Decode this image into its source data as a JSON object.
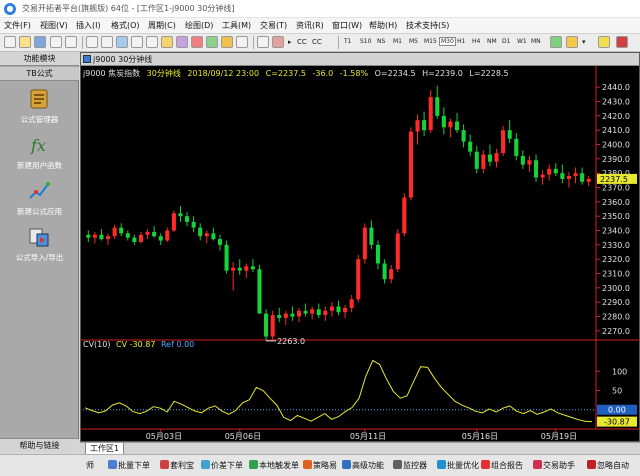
{
  "window": {
    "title": "交易开拓者平台(旗舰版) 64位 - [工作区1-j9000 30分钟线]"
  },
  "menu": [
    "文件(F)",
    "视图(V)",
    "插入(I)",
    "格式(O)",
    "周期(C)",
    "绘图(D)",
    "工具(M)",
    "交易(T)",
    "资讯(R)",
    "窗口(W)",
    "帮助(H)",
    "技术支持(S)"
  ],
  "toolbar": {
    "cc_label": "CC",
    "periods": [
      "T1",
      "S10",
      "NS",
      "M1",
      "M5",
      "M15",
      "M30",
      "H1",
      "H4",
      "NM",
      "D1",
      "W1",
      "MN",
      "MN"
    ],
    "active_period": "M30"
  },
  "left_panel": {
    "header": "功能模块",
    "tab": "TB公式",
    "tools": [
      "公式管理器",
      "新建用户函数",
      "新建公式应用",
      "公式导入/导出"
    ],
    "footer": "帮助与链接"
  },
  "chart": {
    "window_title": "j9000 30分钟线",
    "info": {
      "symbol": "j9000 焦炭指数",
      "period": "30分钟线",
      "datetime": "2018/09/12 23:00",
      "close": "C=2237.5",
      "change": "-36.0",
      "change_pct": "-1.58%",
      "open": "O=2234.5",
      "high": "H=2239.0",
      "low": "L=2228.5"
    },
    "cv_info": {
      "name": "CV(10)",
      "value": "CV -30.87",
      "ref": "Ref 0.00"
    },
    "low_label": "2263.0",
    "price_marker": "2237.5",
    "cv_marker_zero": "0.00",
    "cv_marker_value": "-30.87",
    "colors": {
      "up": "#ff2a2a",
      "down": "#18d23c",
      "cv_line": "#e8e830",
      "axis": "#d42020",
      "ref_line": "#4ea8ff",
      "axis_text": "#e0e0e0"
    }
  },
  "chart_data": {
    "type": "candlestick",
    "price_axis": {
      "ticks": [
        2270.0,
        2280.0,
        2290.0,
        2300.0,
        2310.0,
        2320.0,
        2330.0,
        2340.0,
        2350.0,
        2360.0,
        2370.0,
        2380.0,
        2390.0,
        2400.0,
        2410.0,
        2420.0,
        2430.0,
        2440.0
      ],
      "range": [
        2265,
        2445
      ]
    },
    "cv_axis": {
      "ticks": [
        100,
        50
      ],
      "range": [
        -45,
        145
      ]
    },
    "x_labels": [
      "05月03日",
      "05月06日",
      "05月11日",
      "05月16日",
      "05月19日"
    ],
    "bars": [
      {
        "o": 2337,
        "h": 2340,
        "l": 2332,
        "c": 2335
      },
      {
        "o": 2335,
        "h": 2339,
        "l": 2331,
        "c": 2337
      },
      {
        "o": 2337,
        "h": 2341,
        "l": 2333,
        "c": 2334
      },
      {
        "o": 2334,
        "h": 2338,
        "l": 2330,
        "c": 2336
      },
      {
        "o": 2336,
        "h": 2344,
        "l": 2334,
        "c": 2342
      },
      {
        "o": 2342,
        "h": 2345,
        "l": 2336,
        "c": 2338
      },
      {
        "o": 2338,
        "h": 2340,
        "l": 2333,
        "c": 2335
      },
      {
        "o": 2335,
        "h": 2337,
        "l": 2330,
        "c": 2332
      },
      {
        "o": 2332,
        "h": 2339,
        "l": 2331,
        "c": 2337
      },
      {
        "o": 2337,
        "h": 2341,
        "l": 2334,
        "c": 2339
      },
      {
        "o": 2339,
        "h": 2343,
        "l": 2335,
        "c": 2336
      },
      {
        "o": 2336,
        "h": 2338,
        "l": 2330,
        "c": 2333
      },
      {
        "o": 2333,
        "h": 2342,
        "l": 2332,
        "c": 2340
      },
      {
        "o": 2340,
        "h": 2354,
        "l": 2339,
        "c": 2352
      },
      {
        "o": 2352,
        "h": 2357,
        "l": 2346,
        "c": 2350
      },
      {
        "o": 2350,
        "h": 2353,
        "l": 2343,
        "c": 2346
      },
      {
        "o": 2346,
        "h": 2350,
        "l": 2339,
        "c": 2342
      },
      {
        "o": 2342,
        "h": 2345,
        "l": 2333,
        "c": 2336
      },
      {
        "o": 2336,
        "h": 2340,
        "l": 2331,
        "c": 2338
      },
      {
        "o": 2338,
        "h": 2342,
        "l": 2333,
        "c": 2334
      },
      {
        "o": 2334,
        "h": 2337,
        "l": 2326,
        "c": 2330
      },
      {
        "o": 2330,
        "h": 2333,
        "l": 2310,
        "c": 2312
      },
      {
        "o": 2312,
        "h": 2318,
        "l": 2298,
        "c": 2314
      },
      {
        "o": 2314,
        "h": 2320,
        "l": 2309,
        "c": 2312
      },
      {
        "o": 2312,
        "h": 2317,
        "l": 2307,
        "c": 2315
      },
      {
        "o": 2315,
        "h": 2320,
        "l": 2311,
        "c": 2313
      },
      {
        "o": 2313,
        "h": 2316,
        "l": 2293,
        "c": 2282
      },
      {
        "o": 2282,
        "h": 2285,
        "l": 2263,
        "c": 2266
      },
      {
        "o": 2266,
        "h": 2284,
        "l": 2264,
        "c": 2281
      },
      {
        "o": 2281,
        "h": 2286,
        "l": 2276,
        "c": 2279
      },
      {
        "o": 2279,
        "h": 2284,
        "l": 2274,
        "c": 2282
      },
      {
        "o": 2282,
        "h": 2287,
        "l": 2277,
        "c": 2280
      },
      {
        "o": 2280,
        "h": 2286,
        "l": 2276,
        "c": 2284
      },
      {
        "o": 2284,
        "h": 2289,
        "l": 2280,
        "c": 2282
      },
      {
        "o": 2282,
        "h": 2287,
        "l": 2278,
        "c": 2285
      },
      {
        "o": 2285,
        "h": 2289,
        "l": 2279,
        "c": 2281
      },
      {
        "o": 2281,
        "h": 2287,
        "l": 2277,
        "c": 2284
      },
      {
        "o": 2284,
        "h": 2290,
        "l": 2280,
        "c": 2287
      },
      {
        "o": 2287,
        "h": 2291,
        "l": 2281,
        "c": 2283
      },
      {
        "o": 2283,
        "h": 2288,
        "l": 2279,
        "c": 2286
      },
      {
        "o": 2286,
        "h": 2295,
        "l": 2283,
        "c": 2292
      },
      {
        "o": 2292,
        "h": 2323,
        "l": 2290,
        "c": 2320
      },
      {
        "o": 2320,
        "h": 2345,
        "l": 2317,
        "c": 2342
      },
      {
        "o": 2342,
        "h": 2347,
        "l": 2327,
        "c": 2330
      },
      {
        "o": 2330,
        "h": 2333,
        "l": 2313,
        "c": 2317
      },
      {
        "o": 2317,
        "h": 2320,
        "l": 2303,
        "c": 2306
      },
      {
        "o": 2306,
        "h": 2316,
        "l": 2303,
        "c": 2313
      },
      {
        "o": 2313,
        "h": 2341,
        "l": 2311,
        "c": 2338
      },
      {
        "o": 2338,
        "h": 2366,
        "l": 2336,
        "c": 2363
      },
      {
        "o": 2363,
        "h": 2412,
        "l": 2361,
        "c": 2409
      },
      {
        "o": 2409,
        "h": 2421,
        "l": 2400,
        "c": 2417
      },
      {
        "o": 2417,
        "h": 2423,
        "l": 2406,
        "c": 2410
      },
      {
        "o": 2410,
        "h": 2438,
        "l": 2408,
        "c": 2433
      },
      {
        "o": 2433,
        "h": 2441,
        "l": 2418,
        "c": 2420
      },
      {
        "o": 2420,
        "h": 2426,
        "l": 2407,
        "c": 2412
      },
      {
        "o": 2412,
        "h": 2418,
        "l": 2405,
        "c": 2416
      },
      {
        "o": 2416,
        "h": 2422,
        "l": 2408,
        "c": 2410
      },
      {
        "o": 2410,
        "h": 2414,
        "l": 2398,
        "c": 2402
      },
      {
        "o": 2402,
        "h": 2407,
        "l": 2392,
        "c": 2395
      },
      {
        "o": 2395,
        "h": 2399,
        "l": 2380,
        "c": 2383
      },
      {
        "o": 2383,
        "h": 2396,
        "l": 2380,
        "c": 2393
      },
      {
        "o": 2393,
        "h": 2400,
        "l": 2385,
        "c": 2388
      },
      {
        "o": 2388,
        "h": 2397,
        "l": 2384,
        "c": 2394
      },
      {
        "o": 2394,
        "h": 2413,
        "l": 2392,
        "c": 2410
      },
      {
        "o": 2410,
        "h": 2417,
        "l": 2401,
        "c": 2404
      },
      {
        "o": 2404,
        "h": 2408,
        "l": 2389,
        "c": 2392
      },
      {
        "o": 2392,
        "h": 2396,
        "l": 2383,
        "c": 2386
      },
      {
        "o": 2386,
        "h": 2392,
        "l": 2381,
        "c": 2389
      },
      {
        "o": 2389,
        "h": 2393,
        "l": 2374,
        "c": 2377
      },
      {
        "o": 2377,
        "h": 2382,
        "l": 2372,
        "c": 2379
      },
      {
        "o": 2379,
        "h": 2386,
        "l": 2375,
        "c": 2383
      },
      {
        "o": 2383,
        "h": 2387,
        "l": 2378,
        "c": 2380
      },
      {
        "o": 2380,
        "h": 2386,
        "l": 2373,
        "c": 2376
      },
      {
        "o": 2376,
        "h": 2381,
        "l": 2370,
        "c": 2378
      },
      {
        "o": 2378,
        "h": 2384,
        "l": 2373,
        "c": 2380
      },
      {
        "o": 2380,
        "h": 2384,
        "l": 2372,
        "c": 2374
      },
      {
        "o": 2374,
        "h": 2378,
        "l": 2371,
        "c": 2376
      }
    ],
    "cv": [
      5,
      -2,
      -8,
      -3,
      12,
      18,
      10,
      -5,
      -10,
      -4,
      8,
      4,
      -6,
      22,
      15,
      6,
      -3,
      -8,
      4,
      10,
      -4,
      -12,
      -2,
      18,
      26,
      58,
      50,
      30,
      12,
      -20,
      -28,
      -15,
      -22,
      -30,
      -20,
      -10,
      -25,
      -18,
      -5,
      6,
      30,
      88,
      128,
      118,
      80,
      48,
      30,
      36,
      75,
      112,
      110,
      82,
      58,
      40,
      22,
      12,
      5,
      -4,
      -8,
      2,
      -6,
      4,
      10,
      -4,
      -10,
      -2,
      -12,
      -6,
      2,
      -8,
      -14,
      -20,
      -26,
      -30,
      -31
    ],
    "ref": 0
  },
  "taskbar": [
    "师",
    "批量下单",
    "套利宝",
    "价差下单",
    "本地触发单",
    "策略易",
    "高级功能",
    "监控器",
    "批量优化",
    "组合报告",
    "交易助手",
    "忽略自动"
  ],
  "status": {
    "sheet_tab": "工作区1"
  }
}
